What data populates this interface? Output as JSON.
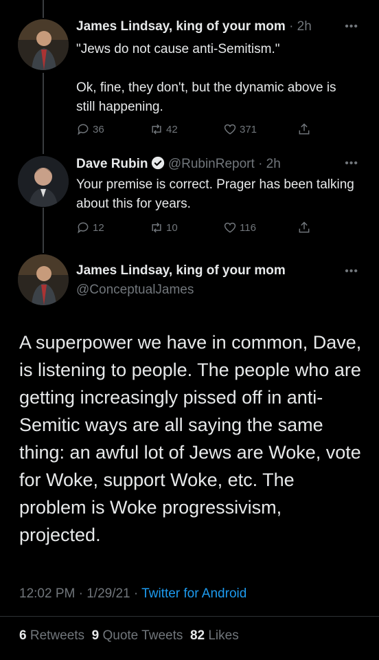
{
  "tweets": [
    {
      "name": "James Lindsay, king of your mom",
      "time": "2h",
      "text": "\"Jews do not cause anti-Semitism.\"\n\nOk, fine, they don't, but the dynamic above is still happening.",
      "replies": "36",
      "retweets": "42",
      "likes": "371"
    },
    {
      "name": "Dave Rubin",
      "handle": "@RubinReport",
      "time": "2h",
      "text": "Your premise is correct. Prager has been talking about this for years.",
      "replies": "12",
      "retweets": "10",
      "likes": "116"
    }
  ],
  "main": {
    "name": "James Lindsay, king of your mom",
    "handle": "@ConceptualJames",
    "text": "A superpower we have in common, Dave, is listening to people. The people who are getting increasingly pissed off in anti-Semitic ways are all saying the same thing: an awful lot of Jews are Woke, vote for Woke, support Woke, etc. The problem is Woke progressivism, projected.",
    "time": "12:02 PM",
    "date": "1/29/21",
    "source": "Twitter for Android",
    "retweets_count": "6",
    "retweets_label": "Retweets",
    "quotes_count": "9",
    "quotes_label": "Quote Tweets",
    "likes_count": "82",
    "likes_label": "Likes"
  },
  "separator": "·",
  "more_glyph": "•••",
  "colors": {
    "background": "#000000",
    "text": "#e7e9ea",
    "muted": "#71767b",
    "accent": "#1d9bf0"
  }
}
